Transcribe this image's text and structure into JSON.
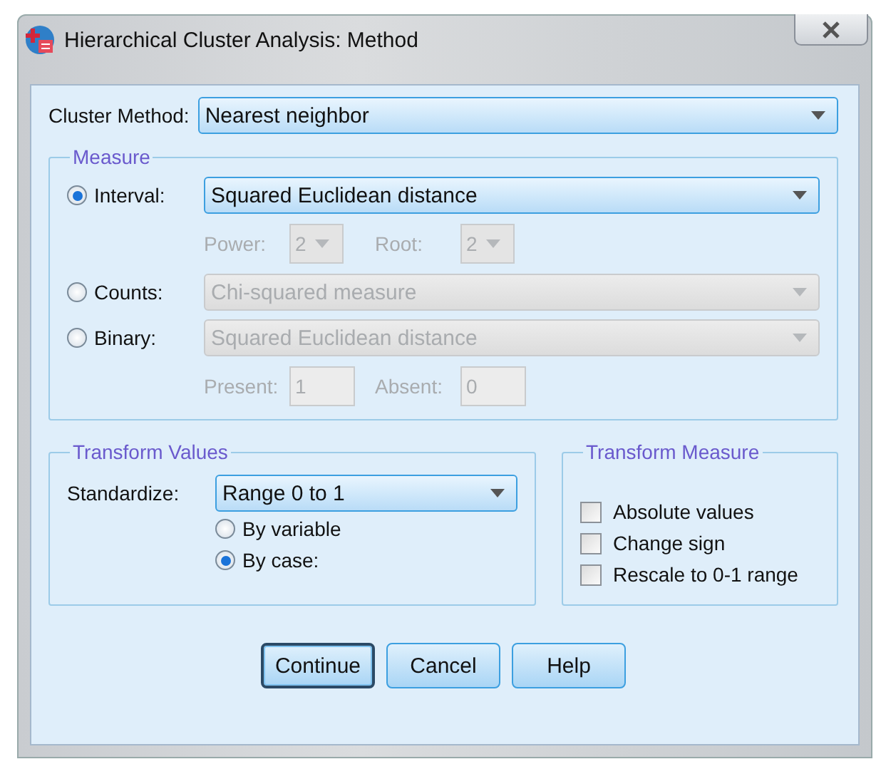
{
  "window": {
    "title": "Hierarchical Cluster Analysis: Method"
  },
  "cluster_method": {
    "label": "Cluster Method:",
    "value": "Nearest neighbor"
  },
  "measure": {
    "title": "Measure",
    "options": [
      {
        "label": "Interval:",
        "selected": true,
        "value": "Squared Euclidean distance",
        "disabled": false,
        "params": [
          {
            "label": "Power:",
            "value": "2",
            "kind": "dropdown",
            "disabled": true
          },
          {
            "label": "Root:",
            "value": "2",
            "kind": "dropdown",
            "disabled": true
          }
        ]
      },
      {
        "label": "Counts:",
        "selected": false,
        "value": "Chi-squared measure",
        "disabled": true
      },
      {
        "label": "Binary:",
        "selected": false,
        "value": "Squared Euclidean distance",
        "disabled": true,
        "params": [
          {
            "label": "Present:",
            "value": "1",
            "kind": "field",
            "disabled": true
          },
          {
            "label": "Absent:",
            "value": "0",
            "kind": "field",
            "disabled": true
          }
        ]
      }
    ]
  },
  "transform_values": {
    "title": "Transform Values",
    "standardize": {
      "label": "Standardize:",
      "value": "Range 0 to 1"
    },
    "options": [
      {
        "label": "By variable",
        "selected": false
      },
      {
        "label": "By case:",
        "selected": true
      }
    ]
  },
  "transform_measure": {
    "title": "Transform Measure",
    "options": [
      {
        "label": "Absolute values",
        "checked": false
      },
      {
        "label": "Change sign",
        "checked": false
      },
      {
        "label": "Rescale to 0-1 range",
        "checked": false
      }
    ]
  },
  "buttons": [
    {
      "label": "Continue",
      "focused": true
    },
    {
      "label": "Cancel",
      "focused": false
    },
    {
      "label": "Help",
      "focused": false
    }
  ]
}
